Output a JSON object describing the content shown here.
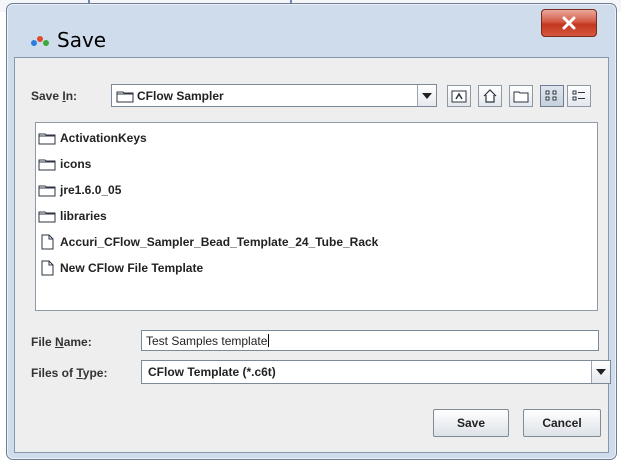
{
  "window": {
    "title": "Save"
  },
  "save_in": {
    "label_prefix": "Save ",
    "label_accel": "I",
    "label_suffix": "n:",
    "value": "CFlow Sampler"
  },
  "toolbar": {
    "buttons": [
      {
        "name": "up-one-level-icon"
      },
      {
        "name": "home-icon"
      },
      {
        "name": "new-folder-icon"
      },
      {
        "name": "list-view-icon"
      },
      {
        "name": "details-view-icon"
      }
    ]
  },
  "files": [
    {
      "name": "ActivationKeys",
      "type": "folder"
    },
    {
      "name": "icons",
      "type": "folder"
    },
    {
      "name": "jre1.6.0_05",
      "type": "folder"
    },
    {
      "name": "libraries",
      "type": "folder"
    },
    {
      "name": "Accuri_CFlow_Sampler_Bead_Template_24_Tube_Rack",
      "type": "file"
    },
    {
      "name": "New CFlow File Template",
      "type": "file"
    }
  ],
  "file_name": {
    "label_prefix": "File ",
    "label_accel": "N",
    "label_suffix": "ame:",
    "value": "Test Samples template"
  },
  "file_type": {
    "label_prefix": "Files of ",
    "label_accel": "T",
    "label_suffix": "ype:",
    "value": "CFlow Template (*.c6t)"
  },
  "buttons": {
    "save": "Save",
    "cancel": "Cancel"
  },
  "colors": {
    "close_button": "#c3361f",
    "frame": "#cfdcec",
    "client": "#eeeeee"
  }
}
